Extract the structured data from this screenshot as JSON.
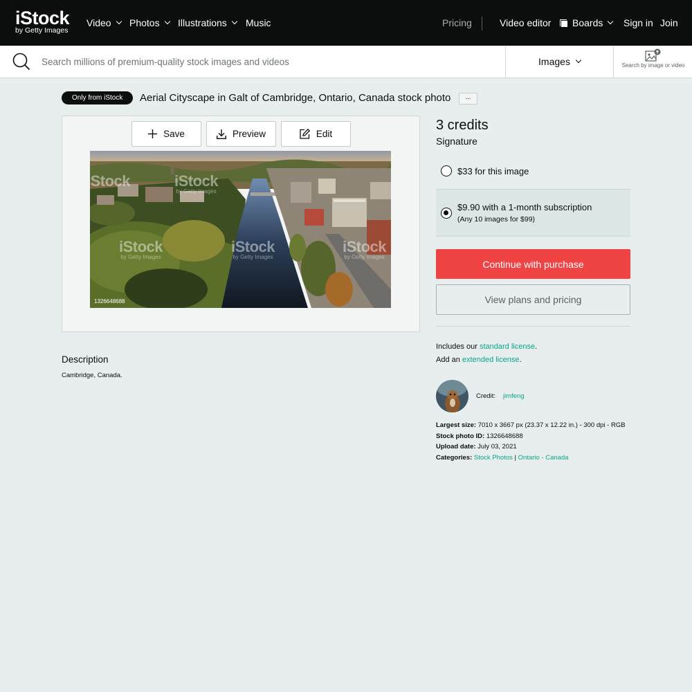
{
  "nav": {
    "logo_main": "iStock",
    "logo_sub": "by Getty Images",
    "video": "Video",
    "photos": "Photos",
    "illustrations": "Illustrations",
    "music": "Music",
    "pricing": "Pricing",
    "video_editor": "Video editor",
    "boards": "Boards",
    "sign_in": "Sign in",
    "join": "Join"
  },
  "search": {
    "placeholder": "Search millions of premium-quality stock images and videos",
    "value": "",
    "type": "Images",
    "by_image_label": "Search by image or video"
  },
  "asset": {
    "badge": "Only from iStock",
    "title": "Aerial Cityscape in Galt of Cambridge, Ontario, Canada stock photo",
    "more": "...",
    "save": "Save",
    "preview": "Preview",
    "edit": "Edit",
    "watermark_main": "iStock",
    "watermark_sub": "by Getty Images",
    "photo_id": "1326648688"
  },
  "description": {
    "heading": "Description",
    "text": "Cambridge, Canada."
  },
  "purchase": {
    "credits": "3 credits",
    "tier": "Signature",
    "option1_label": "$33 for this image",
    "option2_label": "$9.90 with a 1-month subscription",
    "option2_sub": "(Any 10 images for $99)",
    "selected_option": 2,
    "continue": "Continue with purchase",
    "view_plans": "View plans and pricing"
  },
  "license": {
    "includes_prefix": "Includes our ",
    "standard_link": "standard license",
    "period": ".",
    "add_prefix": "Add an ",
    "extended_link": "extended license"
  },
  "credit": {
    "label": "Credit:",
    "name": "jimfeng"
  },
  "meta": {
    "largest_size_label": "Largest size:",
    "largest_size_value": "7010 x 3667 px (23.37 x 12.22 in.) - 300 dpi - RGB",
    "stock_id_label": "Stock photo ID:",
    "stock_id_value": "1326648688",
    "upload_label": "Upload date:",
    "upload_value": "July 03, 2021",
    "categories_label": "Categories:",
    "category_1": "Stock Photos",
    "category_sep": "|",
    "category_2": "Ontario - Canada"
  },
  "colors": {
    "nav_bg": "#0c0d0d",
    "page_bg": "#e8eded",
    "accent_red": "#f04343",
    "link_teal": "#08a88a",
    "selected_option_bg": "#dce6e6"
  },
  "icons": [
    "search-icon",
    "search-by-image-icon",
    "boards-icon",
    "plus-icon",
    "download-icon",
    "edit-icon",
    "chevron-down-icon"
  ]
}
